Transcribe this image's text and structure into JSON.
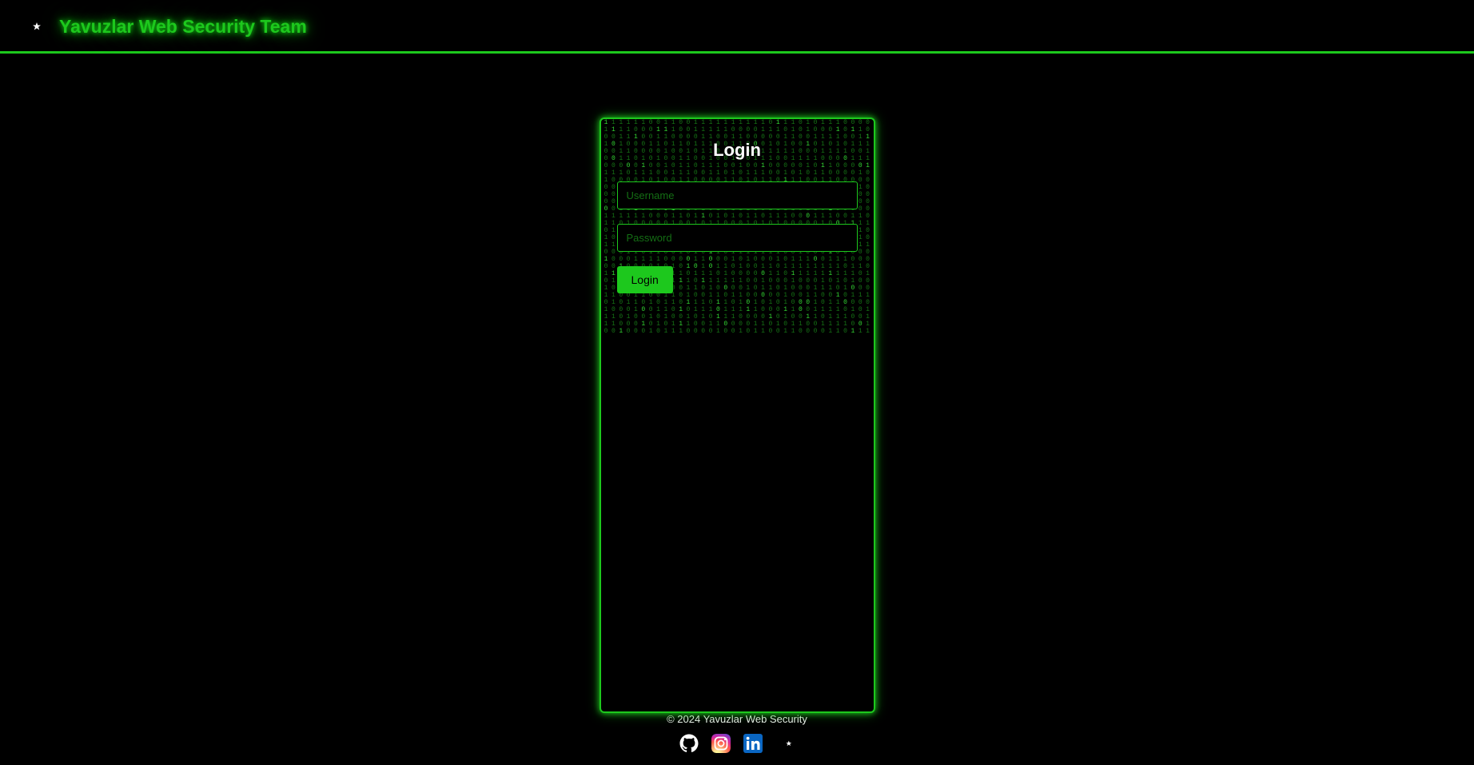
{
  "header": {
    "title": "Yavuzlar Web Security Team"
  },
  "login": {
    "title": "Login",
    "username_placeholder": "Username",
    "password_placeholder": "Password",
    "button_label": "Login"
  },
  "footer": {
    "copyright": "© 2024 Yavuzlar Web Security",
    "icons": {
      "github": "github-icon",
      "instagram": "instagram-icon",
      "linkedin": "linkedin-icon",
      "moon_star": "moon-star-icon"
    }
  }
}
